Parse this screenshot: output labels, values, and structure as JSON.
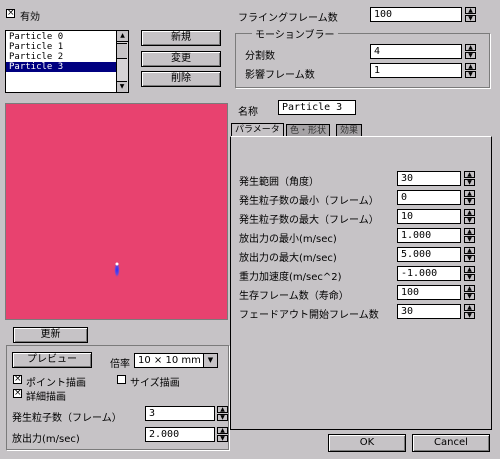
{
  "header": {
    "enabled_label": "有効",
    "enabled_checked": true,
    "flying_frames_label": "フライングフレーム数",
    "flying_frames_value": "100"
  },
  "particle_list": {
    "items": [
      "Particle 0",
      "Particle 1",
      "Particle 2",
      "Particle 3"
    ],
    "selected_index": 3
  },
  "list_buttons": {
    "new": "新規",
    "change": "変更",
    "delete": "削除"
  },
  "motion_blur": {
    "title": "モーションブラー",
    "divisions_label": "分割数",
    "divisions_value": "4",
    "affect_frames_label": "影響フレーム数",
    "affect_frames_value": "1"
  },
  "name": {
    "label": "名称",
    "value": "Particle 3"
  },
  "tabs": [
    "パラメータ",
    "色・形状",
    "効果"
  ],
  "parameters": [
    {
      "label": "発生範囲（角度）",
      "value": "30"
    },
    {
      "label": "発生粒子数の最小（フレーム）",
      "value": "0"
    },
    {
      "label": "発生粒子数の最大（フレーム）",
      "value": "10"
    },
    {
      "label": "放出力の最小(m/sec)",
      "value": "1.000"
    },
    {
      "label": "放出力の最大(m/sec)",
      "value": "5.000"
    },
    {
      "label": "重力加速度(m/sec^2)",
      "value": "-1.000"
    },
    {
      "label": "生存フレーム数（寿命）",
      "value": "100"
    },
    {
      "label": "フェードアウト開始フレーム数",
      "value": "30"
    }
  ],
  "preview": {
    "background_color": "#e8426f",
    "update_label": "更新",
    "preview_button": "プレビュー",
    "scale_label": "倍率",
    "scale_value": "10 × 10 mm",
    "point_draw_label": "ポイント描画",
    "point_draw_checked": true,
    "size_draw_label": "サイズ描画",
    "size_draw_checked": false,
    "detail_draw_label": "詳細描画",
    "detail_draw_checked": true,
    "emit_count_label": "発生粒子数（フレーム）",
    "emit_count_value": "3",
    "emit_force_label": "放出力(m/sec)",
    "emit_force_value": "2.000"
  },
  "footer": {
    "ok": "OK",
    "cancel": "Cancel"
  }
}
